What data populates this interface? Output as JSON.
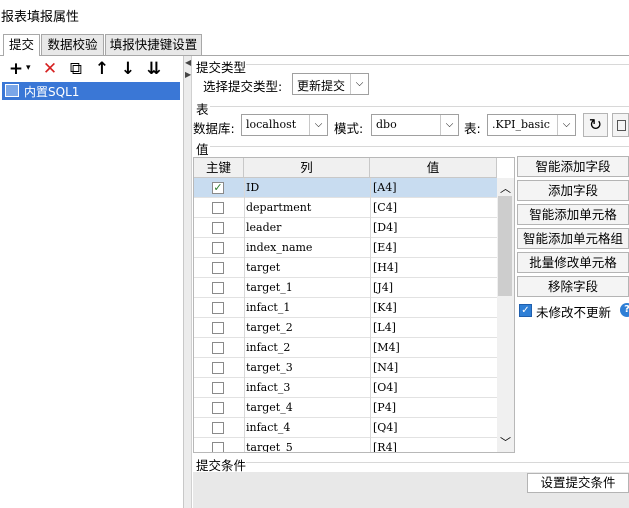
{
  "window": {
    "title": "报表填报属性"
  },
  "tabs": [
    {
      "label": "提交",
      "active": true
    },
    {
      "label": "数据校验",
      "active": false
    },
    {
      "label": "填报快捷键设置",
      "active": false
    }
  ],
  "toolbar": {
    "add": "+",
    "add_dropdown": "▾",
    "delete": "✕",
    "copy": "⧉",
    "move_up": "↑",
    "move_down": "↓",
    "move_bottom": "⇊"
  },
  "tree": {
    "item_label": "内置SQL1"
  },
  "submit_type": {
    "section_label": "提交类型",
    "field_label": "选择提交类型:",
    "value": "更新提交"
  },
  "table_section": {
    "section_label": "表",
    "db_label": "数据库:",
    "db_value": "localhost",
    "schema_label": "模式:",
    "schema_value": "dbo",
    "table_label": "表:",
    "table_value": ".KPI_basic"
  },
  "value_section": {
    "section_label": "值",
    "headers": {
      "pk": "主键",
      "col": "列",
      "val": "值"
    },
    "rows": [
      {
        "pk": true,
        "col": "ID",
        "val": "[A4]"
      },
      {
        "pk": false,
        "col": "department",
        "val": "[C4]"
      },
      {
        "pk": false,
        "col": "leader",
        "val": "[D4]"
      },
      {
        "pk": false,
        "col": "index_name",
        "val": "[E4]"
      },
      {
        "pk": false,
        "col": "target",
        "val": "[H4]"
      },
      {
        "pk": false,
        "col": "target_1",
        "val": "[J4]"
      },
      {
        "pk": false,
        "col": "infact_1",
        "val": "[K4]"
      },
      {
        "pk": false,
        "col": "target_2",
        "val": "[L4]"
      },
      {
        "pk": false,
        "col": "infact_2",
        "val": "[M4]"
      },
      {
        "pk": false,
        "col": "target_3",
        "val": "[N4]"
      },
      {
        "pk": false,
        "col": "infact_3",
        "val": "[O4]"
      },
      {
        "pk": false,
        "col": "target_4",
        "val": "[P4]"
      },
      {
        "pk": false,
        "col": "infact_4",
        "val": "[Q4]"
      },
      {
        "pk": false,
        "col": "target_5",
        "val": "[R4]"
      }
    ],
    "buttons": {
      "smart_add_field": "智能添加字段",
      "add_field": "添加字段",
      "smart_add_cell": "智能添加单元格",
      "smart_add_cell_group": "智能添加单元格组",
      "batch_modify_cell": "批量修改单元格",
      "remove_field": "移除字段"
    },
    "no_update_unmodified": "未修改不更新",
    "help": "?"
  },
  "condition_section": {
    "section_label": "提交条件",
    "set_button": "设置提交条件"
  }
}
